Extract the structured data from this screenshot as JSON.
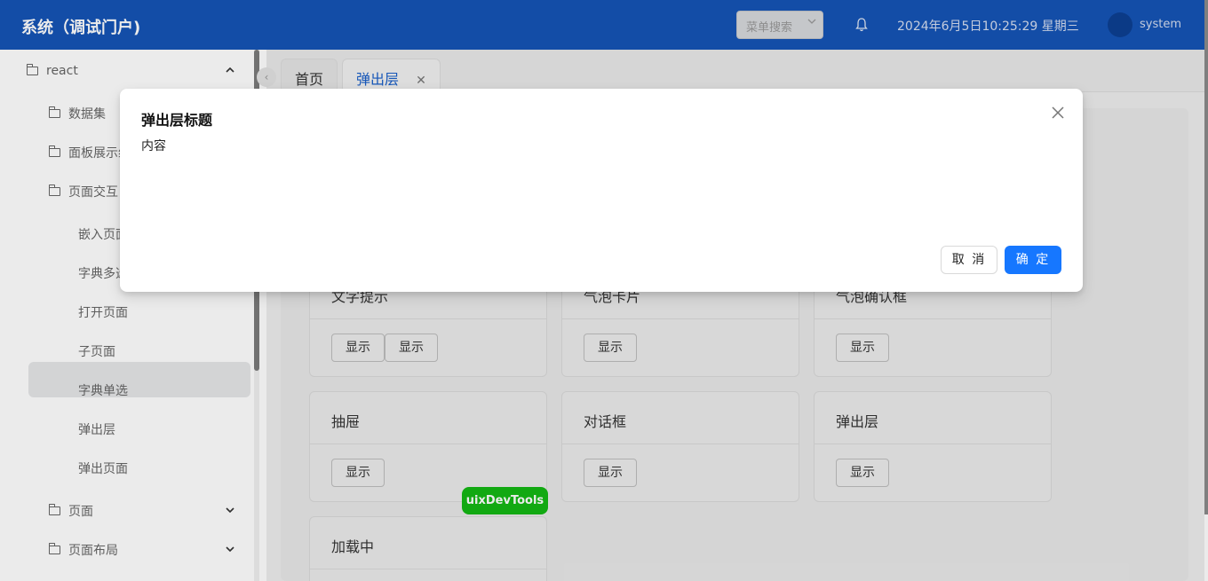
{
  "header": {
    "title": "系统（调试门户)",
    "menu_search": "菜单搜索",
    "datetime": "2024年6月5日10:25:29 星期三",
    "username": "system"
  },
  "sidebar": {
    "root": "react",
    "items": [
      {
        "label": "数据集"
      },
      {
        "label": "面板展示组"
      },
      {
        "label": "页面交互"
      },
      {
        "label": "嵌入页面"
      },
      {
        "label": "字典多选"
      },
      {
        "label": "打开页面"
      },
      {
        "label": "子页面"
      },
      {
        "label": "字典单选"
      },
      {
        "label": "弹出层"
      },
      {
        "label": "弹出页面"
      },
      {
        "label": "页面"
      },
      {
        "label": "页面布局"
      }
    ]
  },
  "tabs": [
    {
      "label": "首页"
    },
    {
      "label": "弹出层",
      "close": "✕"
    }
  ],
  "cards": [
    {
      "title": "文字提示",
      "buttons": [
        "显示",
        "显示"
      ]
    },
    {
      "title": "气泡卡片",
      "buttons": [
        "显示"
      ]
    },
    {
      "title": "气泡确认框",
      "buttons": [
        "显示"
      ]
    },
    {
      "title": "抽屉",
      "buttons": [
        "显示"
      ]
    },
    {
      "title": "对话框",
      "buttons": [
        "显示"
      ]
    },
    {
      "title": "弹出层",
      "buttons": [
        "显示"
      ]
    },
    {
      "title": "加载中",
      "buttons": []
    }
  ],
  "devtools_label": "uixDevTools",
  "modal": {
    "title": "弹出层标题",
    "body": "内容",
    "cancel": "取 消",
    "ok": "确 定"
  },
  "colors": {
    "header": "#1554b6",
    "primary": "#1677ff",
    "devtools": "#14b814"
  }
}
